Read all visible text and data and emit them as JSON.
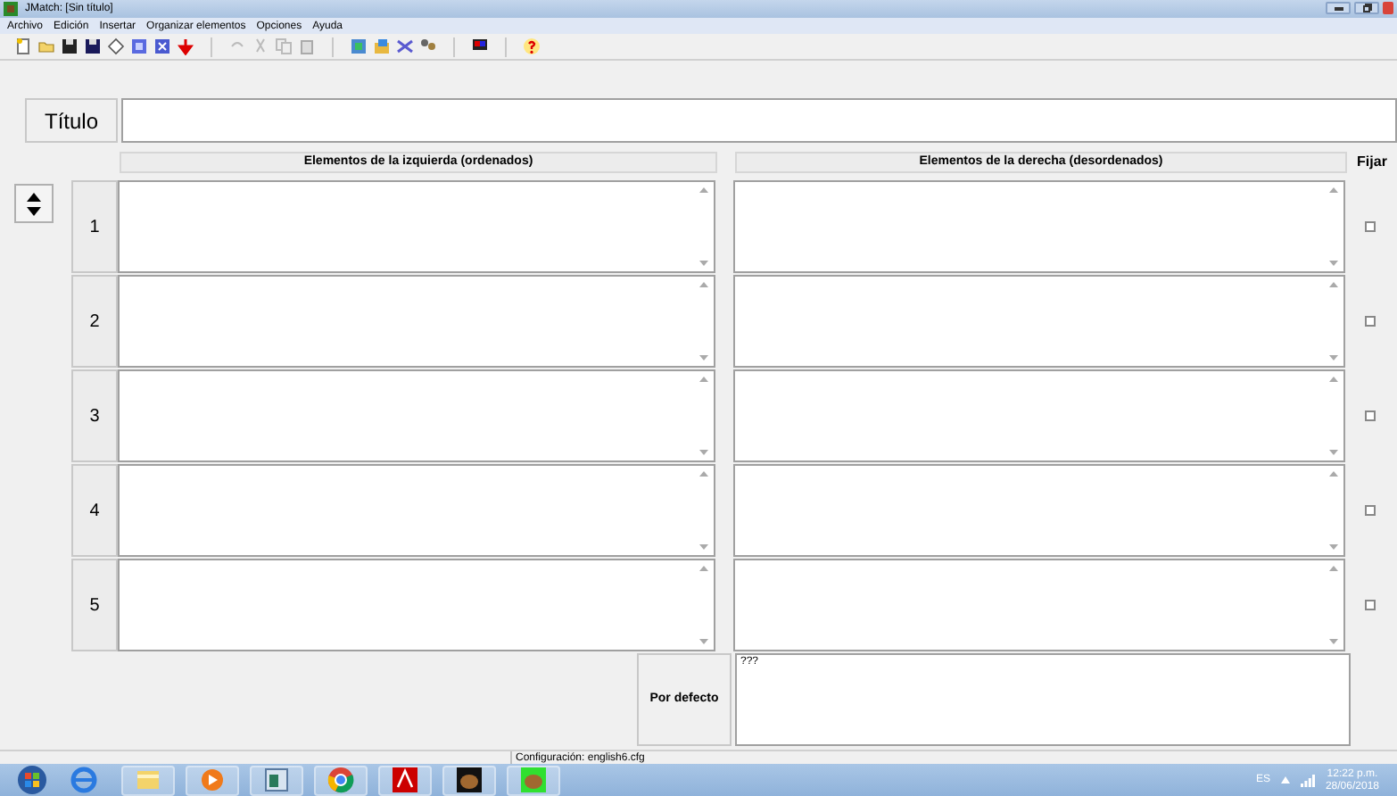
{
  "window": {
    "title": "JMatch: [Sin título]"
  },
  "menu": [
    {
      "label": "Archivo"
    },
    {
      "label": "Edición"
    },
    {
      "label": "Insertar"
    },
    {
      "label": "Organizar elementos"
    },
    {
      "label": "Opciones"
    },
    {
      "label": "Ayuda"
    }
  ],
  "title_field": {
    "label": "Título"
  },
  "columns": [
    "Elementos de la izquierda (ordenados)",
    "Elementos de la derecha (desordenados)",
    "Fijar"
  ],
  "rows": [
    {
      "number": "1",
      "fixed": false
    },
    {
      "number": "2",
      "fixed": false
    },
    {
      "number": "3",
      "fixed": false
    },
    {
      "number": "4",
      "fixed": false
    },
    {
      "number": "5",
      "fixed": false
    }
  ],
  "default": {
    "label": "Por defecto",
    "value": "???"
  },
  "status_bar": "Configuración: english6.cfg",
  "taskbar": {
    "language": "ES",
    "time": "12:22 p.m.",
    "date": "28/06/2018"
  }
}
